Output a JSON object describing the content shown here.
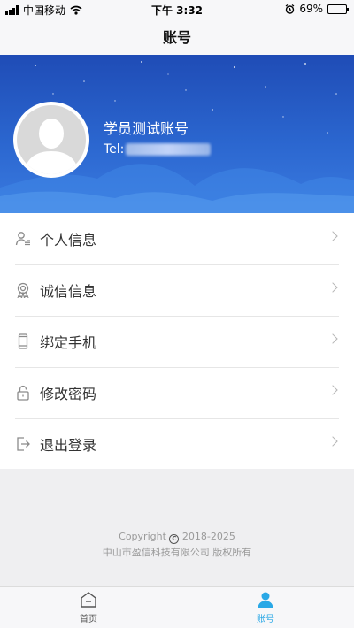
{
  "status_bar": {
    "carrier": "中国移动",
    "time": "下午 3:32",
    "battery_percent": "69%",
    "battery_level": 0.69
  },
  "header": {
    "title": "账号"
  },
  "profile": {
    "name": "学员测试账号",
    "tel_label": "Tel:"
  },
  "menu": {
    "items": [
      {
        "label": "个人信息",
        "icon": "person-icon"
      },
      {
        "label": "诚信信息",
        "icon": "badge-icon"
      },
      {
        "label": "绑定手机",
        "icon": "phone-icon"
      },
      {
        "label": "修改密码",
        "icon": "lock-icon"
      },
      {
        "label": "退出登录",
        "icon": "logout-icon"
      }
    ]
  },
  "footer": {
    "copyright_prefix": "Copyright",
    "copyright_years": "2018-2025",
    "company": "中山市盈信科技有限公司 版权所有"
  },
  "tabbar": {
    "tabs": [
      {
        "label": "首页",
        "icon": "home-icon",
        "active": false
      },
      {
        "label": "账号",
        "icon": "account-icon",
        "active": true
      }
    ]
  },
  "colors": {
    "banner": "#2b66cf",
    "tab_active": "#2aa8e6"
  }
}
